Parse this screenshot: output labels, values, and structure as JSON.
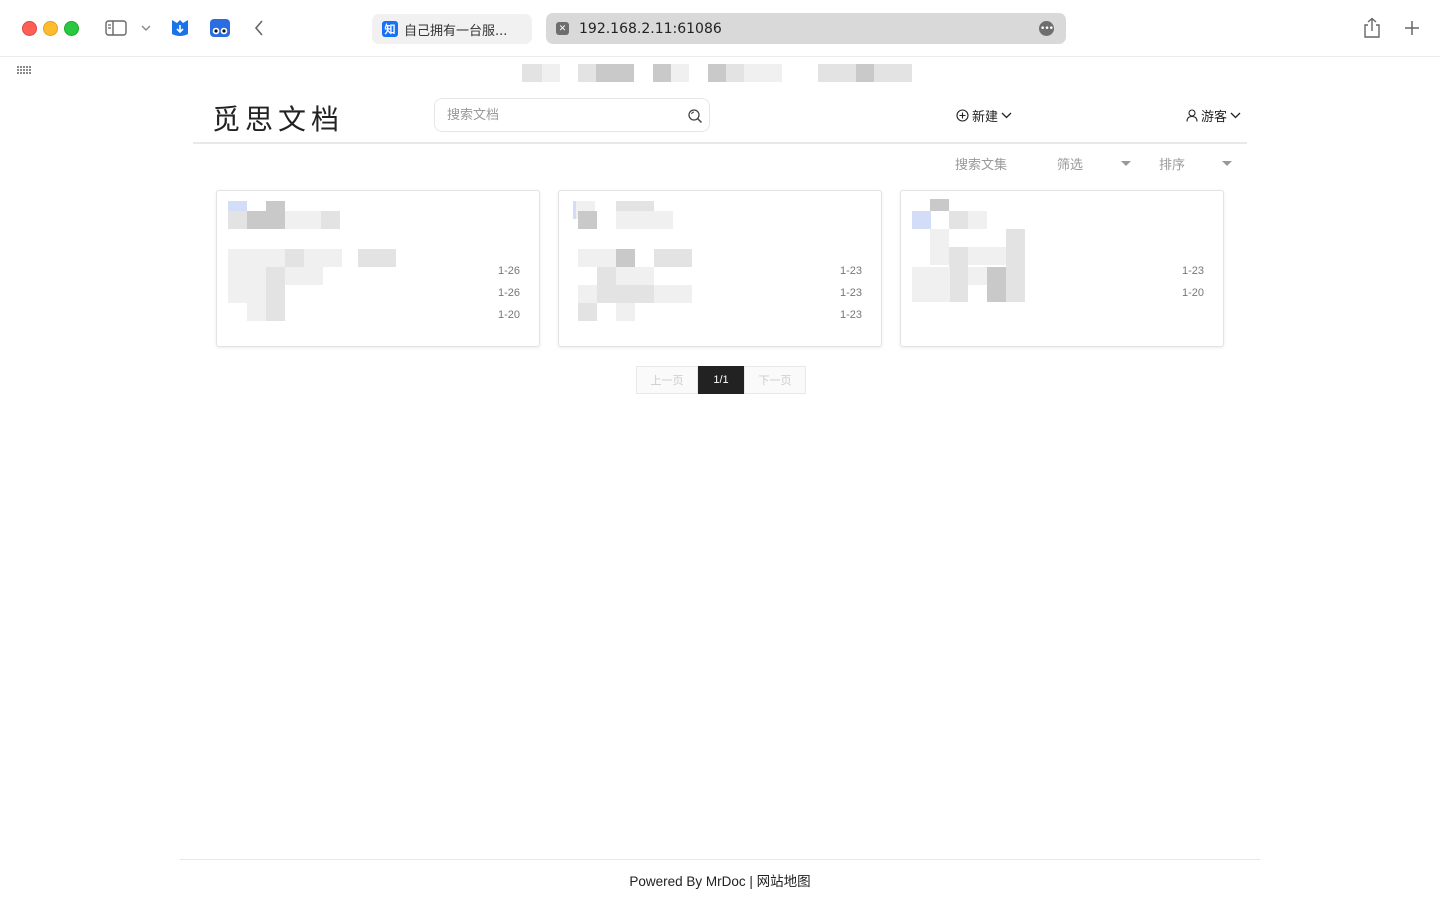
{
  "browser": {
    "tabs": [
      {
        "label": "自己拥有一台服...",
        "favicon": "知",
        "favicon_color": "#1772f6"
      },
      {
        "label": "192.168.2.11:61086"
      }
    ]
  },
  "header": {
    "logo": "觅思文档",
    "search_placeholder": "搜索文档",
    "new_label": "新建",
    "user_label": "游客"
  },
  "filters": {
    "search_collection": "搜索文集",
    "filter": "筛选",
    "sort": "排序"
  },
  "cards": [
    {
      "dates": [
        "1-26",
        "1-26",
        "1-20"
      ]
    },
    {
      "dates": [
        "1-23",
        "1-23",
        "1-23"
      ]
    },
    {
      "dates": [
        "1-23",
        "1-20"
      ]
    }
  ],
  "pagination": {
    "prev": "上一页",
    "current": "1/1",
    "next": "下一页"
  },
  "footer": {
    "powered": "Powered By MrDoc |",
    "sitemap": "网站地图"
  }
}
